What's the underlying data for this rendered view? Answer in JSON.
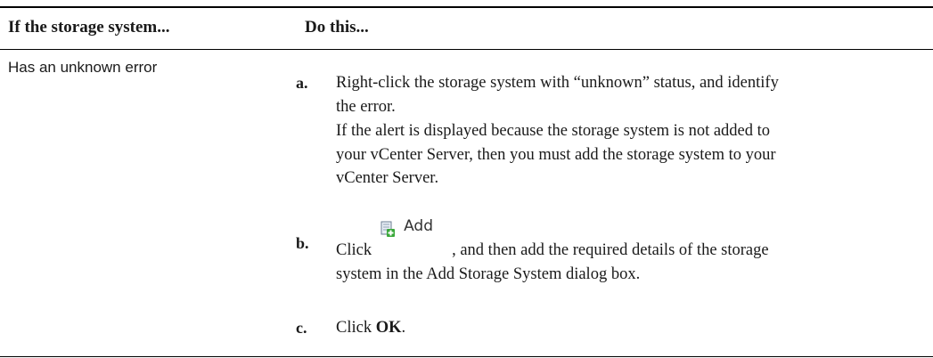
{
  "table": {
    "headers": [
      "If the storage system...",
      "Do this..."
    ],
    "condition": "Has an unknown error",
    "steps": [
      {
        "marker": "a.",
        "lines": [
          "Right-click the storage system with “unknown” status, and identify",
          "the error.",
          "If the alert is displayed because the storage system is not added to",
          "your vCenter Server, then you must add the storage system to your",
          "vCenter Server."
        ]
      },
      {
        "marker": "b.",
        "prefix": "Click",
        "button_label": "Add",
        "button_icon": "add-storage-icon",
        "suffix": ", and then add the required details of the storage",
        "line2": "system in the Add Storage System dialog box."
      },
      {
        "marker": "c.",
        "prefix": "Click",
        "bold": "OK",
        "suffix": "."
      }
    ]
  },
  "colors": {
    "icon_green": "#3aa83a",
    "icon_sheet": "#e8eef5",
    "icon_border": "#6d7f93"
  }
}
